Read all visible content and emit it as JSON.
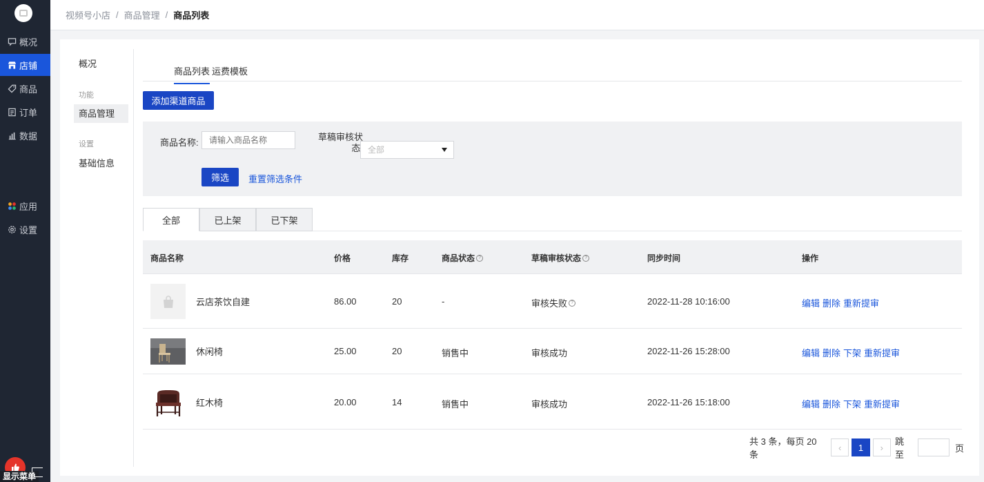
{
  "sidebar": {
    "items": [
      {
        "label": "概况",
        "icon": "chat-icon"
      },
      {
        "label": "店铺",
        "icon": "store-icon"
      },
      {
        "label": "商品",
        "icon": "tag-icon"
      },
      {
        "label": "订单",
        "icon": "order-icon"
      },
      {
        "label": "数据",
        "icon": "bar-chart-icon"
      }
    ],
    "bottom_items": [
      {
        "label": "应用",
        "icon": "apps-icon"
      },
      {
        "label": "设置",
        "icon": "gear-icon"
      }
    ],
    "feedback_label": "显示菜单"
  },
  "breadcrumb": {
    "items": [
      "视频号小店",
      "商品管理",
      "商品列表"
    ],
    "separator": "/"
  },
  "subnav": {
    "overview": "概况",
    "group_function": "功能",
    "product_manage": "商品管理",
    "group_settings": "设置",
    "basic_info": "基础信息"
  },
  "tabs": {
    "product_list": "商品列表",
    "shipping_template": "运费模板"
  },
  "add_button": "添加渠道商品",
  "filter": {
    "name_label": "商品名称:",
    "name_placeholder": "请输入商品名称",
    "status_label_line1": "草稿审核状",
    "status_label_line2": "态:",
    "status_value": "全部",
    "submit": "筛选",
    "reset": "重置筛选条件"
  },
  "segments": [
    "全部",
    "已上架",
    "已下架"
  ],
  "table": {
    "headers": {
      "name": "商品名称",
      "price": "价格",
      "stock": "库存",
      "status": "商品状态",
      "audit": "草稿审核状态",
      "sync_time": "同步时间",
      "ops": "操作"
    },
    "rows": [
      {
        "name": "云店茶饮自建",
        "price": "86.00",
        "stock": "20",
        "status": "-",
        "audit": "审核失败",
        "sync_time": "2022-11-28 10:16:00",
        "ops": [
          "编辑",
          "删除",
          "重新提审"
        ]
      },
      {
        "name": "休闲椅",
        "price": "25.00",
        "stock": "20",
        "status": "销售中",
        "audit": "审核成功",
        "sync_time": "2022-11-26 15:28:00",
        "ops": [
          "编辑",
          "删除",
          "下架",
          "重新提审"
        ]
      },
      {
        "name": "红木椅",
        "price": "20.00",
        "stock": "14",
        "status": "销售中",
        "audit": "审核成功",
        "sync_time": "2022-11-26 15:18:00",
        "ops": [
          "编辑",
          "删除",
          "下架",
          "重新提审"
        ]
      }
    ]
  },
  "pagination": {
    "summary": "共 3 条，每页 20 条",
    "prev": "‹",
    "current_page": "1",
    "next": "›",
    "jump_label": "跳至",
    "page_unit": "页"
  },
  "colors": {
    "sidebar_bg": "#1f2633",
    "accent": "#1a56db",
    "primary_button": "#1a46c4"
  }
}
